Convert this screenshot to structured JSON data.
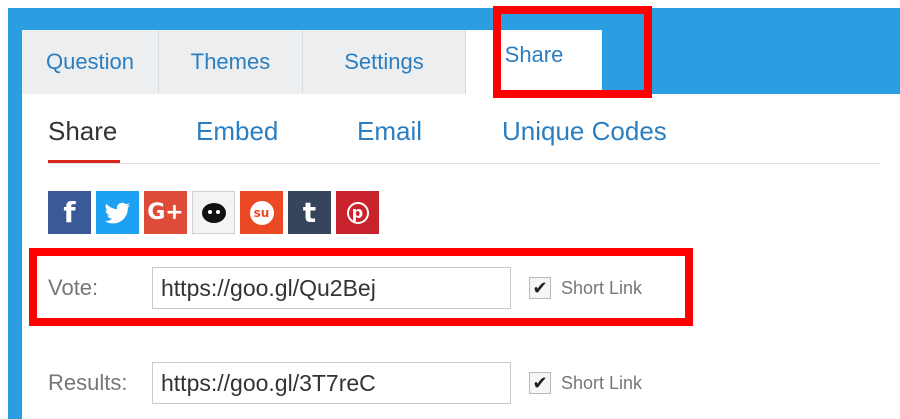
{
  "tabs": [
    {
      "label": "Question"
    },
    {
      "label": "Themes"
    },
    {
      "label": "Settings"
    },
    {
      "label": "Share"
    }
  ],
  "subtabs": [
    {
      "label": "Share"
    },
    {
      "label": "Embed"
    },
    {
      "label": "Email"
    },
    {
      "label": "Unique Codes"
    }
  ],
  "social_icons": [
    {
      "name": "facebook",
      "glyph": "f",
      "color": "#3b5998"
    },
    {
      "name": "twitter",
      "glyph": "",
      "color": "#1da1f2"
    },
    {
      "name": "google-plus",
      "glyph": "G+",
      "color": "#dd4b39"
    },
    {
      "name": "reddit",
      "glyph": "",
      "color": "#f4f4f4"
    },
    {
      "name": "stumbleupon",
      "glyph": "su",
      "color": "#eb4924"
    },
    {
      "name": "tumblr",
      "glyph": "t",
      "color": "#35465c"
    },
    {
      "name": "pinterest",
      "glyph": "p",
      "color": "#c8232c"
    }
  ],
  "vote": {
    "label": "Vote:",
    "url": "https://goo.gl/Qu2Bej",
    "short_link_label": "Short Link",
    "short_link_checked": true
  },
  "results": {
    "label": "Results:",
    "url": "https://goo.gl/3T7reC",
    "short_link_label": "Short Link",
    "short_link_checked": true
  },
  "colors": {
    "accent_blue": "#2a9ee0",
    "highlight_red": "#ff0000",
    "active_underline": "#d9261c"
  }
}
